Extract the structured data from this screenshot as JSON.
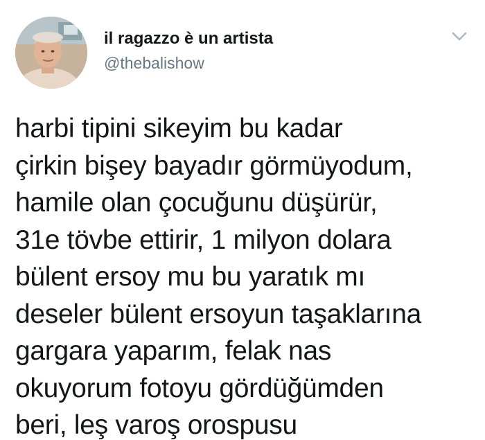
{
  "user": {
    "display_name": "il ragazzo è un artista",
    "handle": "@thebalishow"
  },
  "tweet": {
    "lines": [
      "harbi tipini sikeyim bu kadar",
      "çirkin bişey bayadır görmüyodum,",
      "hamile olan çocuğunu düşürür,",
      "31e tövbe ettirir, 1 milyon dolara",
      "bülent ersoy mu bu yaratık mı",
      "deseler bülent ersoyun taşaklarına",
      "gargara yaparım, felak nas",
      "okuyorum fotoyu gördüğümden",
      "beri, leş varoş orospusu"
    ]
  },
  "icons": {
    "menu": "chevron-down-icon",
    "avatar": "profile-photo"
  },
  "colors": {
    "text": "#14171a",
    "secondary": "#657786",
    "caret": "#aab8c2"
  }
}
